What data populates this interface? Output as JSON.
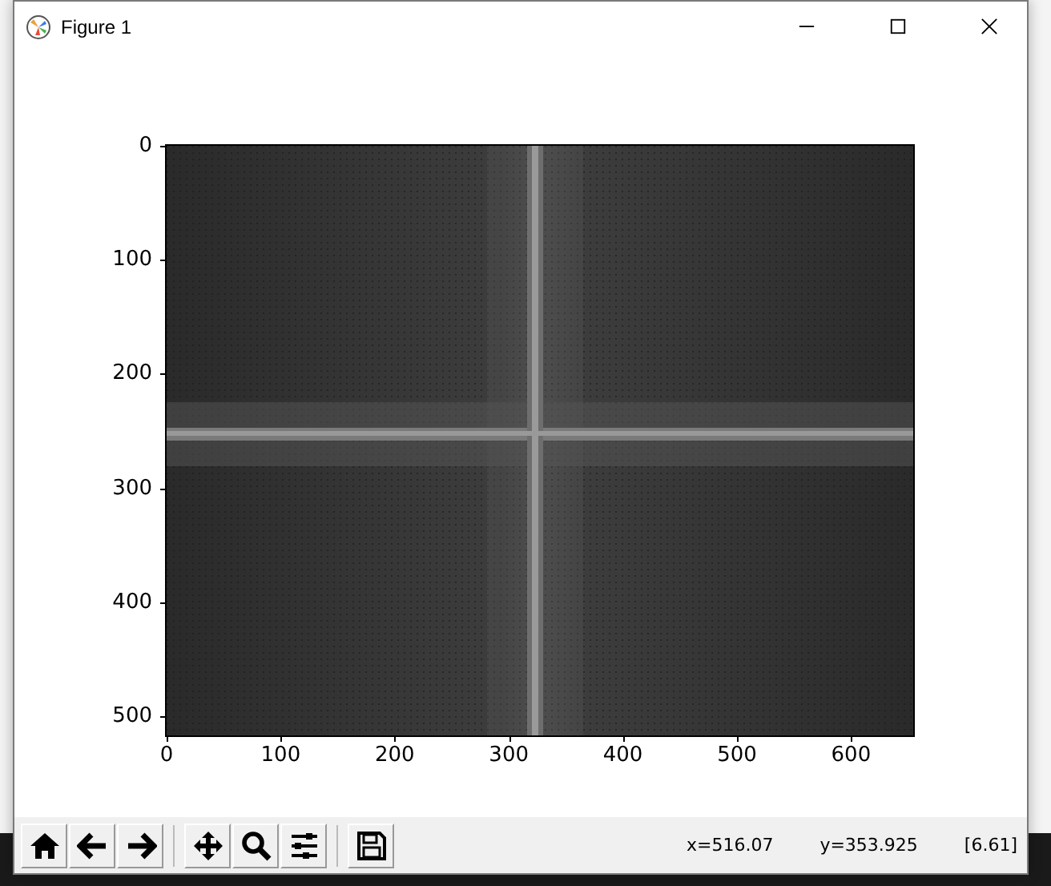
{
  "window": {
    "title": "Figure 1"
  },
  "plot": {
    "kind": "picture",
    "yticks": [
      "0",
      "100",
      "200",
      "300",
      "400",
      "500"
    ],
    "xticks": [
      "0",
      "100",
      "200",
      "300",
      "400",
      "500",
      "600"
    ]
  },
  "toolbar": {
    "groups": [
      [
        {
          "kind": "home"
        },
        {
          "kind": "back"
        },
        {
          "kind": "forward"
        }
      ],
      [
        {
          "kind": "pan"
        },
        {
          "kind": "zoom"
        },
        {
          "kind": "configure"
        }
      ],
      [
        {
          "kind": "save"
        }
      ]
    ]
  },
  "status": [
    "x=516.07",
    "y=353.925",
    "[6.61]"
  ]
}
